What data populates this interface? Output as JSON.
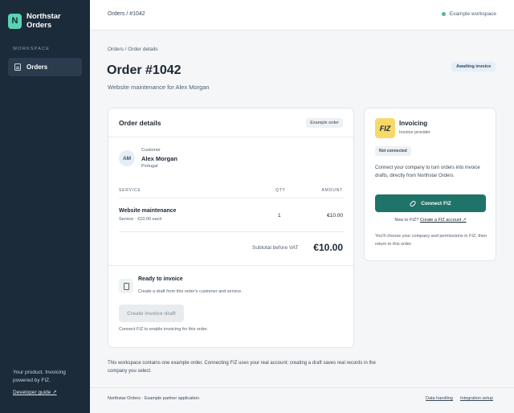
{
  "brand": {
    "logo_letter": "N",
    "name": "Northstar Orders",
    "logo_color": "#5ad3b0"
  },
  "sidebar": {
    "section_label": "WORKSPACE",
    "items": [
      {
        "label": "Orders",
        "icon": "clipboard-icon",
        "active": true
      }
    ],
    "footer_text": "Your product. Invoicing powered by FIZ.",
    "developer_link": "Developer guide ↗"
  },
  "topbar": {
    "breadcrumb": "Orders / #1042",
    "workspace_badge": "Example workspace",
    "workspace_dot_color": "#54b88e"
  },
  "page": {
    "breadcrumb": "Orders / Order details",
    "title": "Order #1042",
    "subtitle": "Website maintenance for Alex Morgan",
    "status_badge": "Awaiting invoice"
  },
  "order_card": {
    "heading": "Order details",
    "badge": "Example order",
    "customer": {
      "initials": "AM",
      "label": "Customer",
      "name": "Alex Morgan",
      "country": "Portugal"
    },
    "columns": {
      "service": "SERVICE",
      "qty": "QTY",
      "amount": "AMOUNT"
    },
    "line_item": {
      "name": "Website maintenance",
      "meta": "Service · €10.00 each",
      "qty": "1",
      "amount": "€10.00"
    },
    "subtotal_label": "Subtotal before VAT",
    "subtotal_value": "€10.00",
    "ready": {
      "icon": "clipboard-icon",
      "title": "Ready to invoice",
      "description": "Create a draft from this order's customer and service.",
      "button_label": "Create invoice draft",
      "note": "Connect FIZ to enable invoicing for this order."
    }
  },
  "invoicing_card": {
    "logo_text": "FIZ",
    "logo_color": "#f7d96a",
    "title": "Invoicing",
    "subtitle": "Invoice provider",
    "status_badge": "Not connected",
    "description": "Connect your company to turn orders into invoice drafts, directly from Northstar Orders.",
    "connect_button": "Connect FIZ",
    "connect_icon": "link-icon",
    "button_color": "#1f7368",
    "new_prompt": "New to FIZ?",
    "create_account_link": "Create a FIZ account ↗",
    "permissions_note": "You'll choose your company and permissions in FIZ, then return to this order."
  },
  "workspace_note": "This workspace contains one example order. Connecting FIZ uses your real account; creating a draft saves real records in the company you select.",
  "footer": {
    "left": "Northstar Orders · Example partner application",
    "links": [
      "Data handling",
      "Integration setup"
    ]
  }
}
